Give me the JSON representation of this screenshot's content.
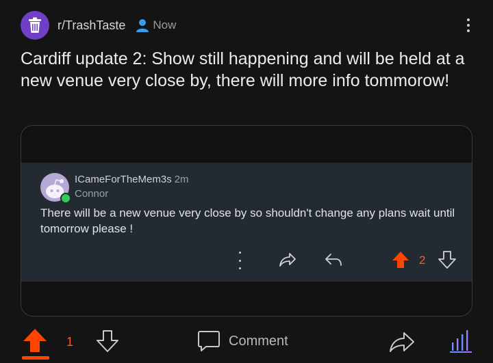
{
  "post": {
    "subreddit": "r/TrashTaste",
    "time": "Now",
    "title": "Cardiff update 2: Show still happening and will be held at a new venue very close by, there will more info tommorow!",
    "score": "1",
    "comment_label": "Comment"
  },
  "comment": {
    "username": "ICameForTheMem3s",
    "time": "2m",
    "flair": "Connor",
    "body": "There will be a new venue very close by so shouldn't change any plans wait until tomorrow please !",
    "score": "2"
  },
  "colors": {
    "background": "#141414",
    "upvote_active": "#ff4500",
    "subreddit_avatar": "#6f3fc6",
    "comment_card": "#232a31",
    "online": "#2ecc59",
    "stats_gradient": [
      "#4aa3ff",
      "#b46cff"
    ]
  },
  "icons": [
    "trash-can-icon",
    "user-icon",
    "more-vertical-icon",
    "share-icon",
    "reply-icon",
    "upvote-icon",
    "downvote-icon",
    "comment-icon",
    "stats-icon",
    "snoo-avatar-icon"
  ]
}
